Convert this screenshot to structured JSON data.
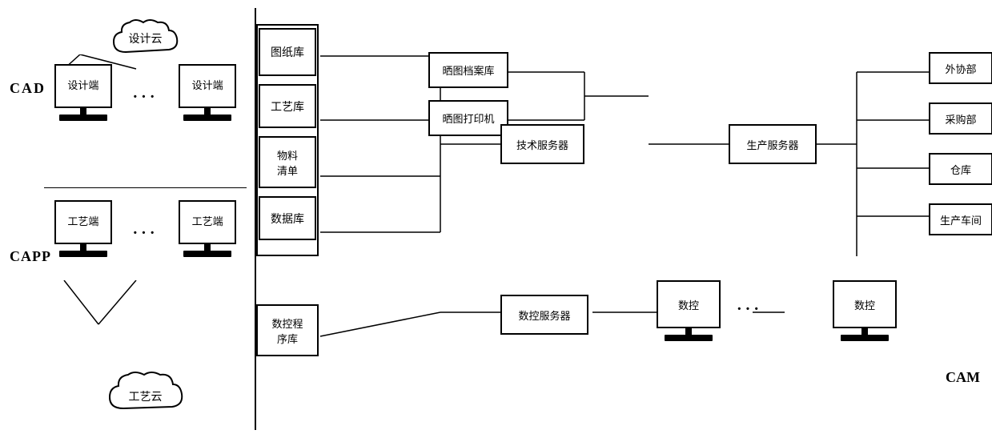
{
  "labels": {
    "cad": "CAD",
    "capp": "CAPP",
    "cam": "CAM"
  },
  "cad_section": {
    "cloud_label": "设计云",
    "terminal1": "设计端",
    "terminal2": "设计端",
    "dots": "···"
  },
  "capp_section": {
    "terminal1": "工艺端",
    "terminal2": "工艺端",
    "dots": "···",
    "cloud_label": "工艺云"
  },
  "right_section": {
    "boxes": {
      "drawing_lib": "图纸库",
      "process_lib": "工艺库",
      "bom": "物料\n清单",
      "database": "数据库",
      "nc_program": "数控程\n序库",
      "blueprint_archive": "晒图档案库",
      "blueprint_printer": "晒图打印机",
      "tech_server": "技术服务器",
      "production_server": "生产服务器",
      "nc_server": "数控服务器",
      "nc1": "数控",
      "nc2": "数控",
      "dept_ext": "外协部",
      "dept_purchase": "采购部",
      "dept_warehouse": "仓库",
      "dept_production": "生产车间"
    },
    "dots": "···"
  }
}
